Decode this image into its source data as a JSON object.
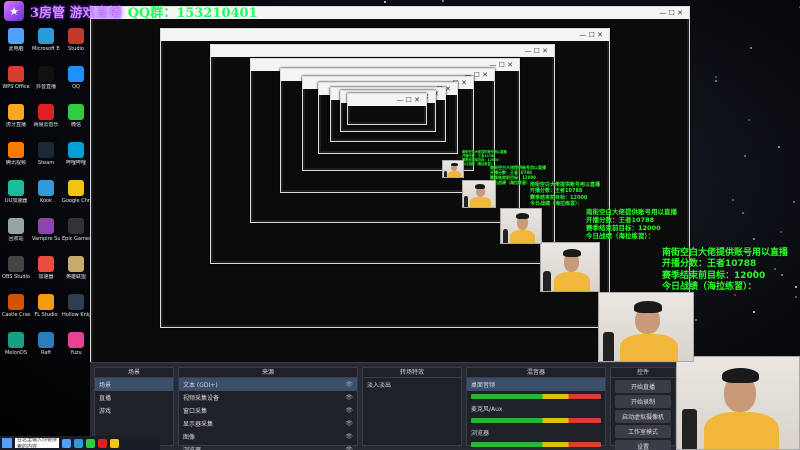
{
  "banner": {
    "streamer_name": "3房管 游戏直播",
    "qq_group": "QQ群：153210401"
  },
  "colors": {
    "overlay_text": "#2bff2b",
    "banner_name": "#d38bff",
    "obs_bg": "#272a33"
  },
  "desktop_icons": [
    {
      "label": "此电脑",
      "icon": "computer-icon",
      "color": "#4fa3ff"
    },
    {
      "label": "Microsoft Edge",
      "icon": "edge-icon",
      "color": "#2c9ad7"
    },
    {
      "label": "Studio",
      "icon": "app-icon",
      "color": "#c0392b"
    },
    {
      "label": "WPS Office",
      "icon": "wps-icon",
      "color": "#d63b2f"
    },
    {
      "label": "抖音直播",
      "icon": "douyin-icon",
      "color": "#111111"
    },
    {
      "label": "QQ",
      "icon": "qq-icon",
      "color": "#1e90ff"
    },
    {
      "label": "虎牙直播",
      "icon": "huya-icon",
      "color": "#f5a623"
    },
    {
      "label": "网易云音乐",
      "icon": "music-icon",
      "color": "#e02020"
    },
    {
      "label": "微信",
      "icon": "wechat-icon",
      "color": "#2ecc40"
    },
    {
      "label": "腾讯视频",
      "icon": "video-icon",
      "color": "#ff7a00"
    },
    {
      "label": "Steam",
      "icon": "steam-icon",
      "color": "#1b2838"
    },
    {
      "label": "哔哩哔哩",
      "icon": "bilibili-icon",
      "color": "#00a1d6"
    },
    {
      "label": "UU加速器",
      "icon": "uu-icon",
      "color": "#1abc9c"
    },
    {
      "label": "Kook",
      "icon": "kook-icon",
      "color": "#3498db"
    },
    {
      "label": "Google Chrome",
      "icon": "chrome-icon",
      "color": "#f1c40f"
    },
    {
      "label": "回收站",
      "icon": "recycle-bin-icon",
      "color": "#95a5a6"
    },
    {
      "label": "Vampire Survivors",
      "icon": "game-icon",
      "color": "#8e44ad"
    },
    {
      "label": "Epic Games",
      "icon": "epic-icon",
      "color": "#333333"
    },
    {
      "label": "OBS Studio",
      "icon": "obs-icon",
      "color": "#444444"
    },
    {
      "label": "加速器",
      "icon": "boost-icon",
      "color": "#e74c3c"
    },
    {
      "label": "英雄联盟",
      "icon": "lol-icon",
      "color": "#c8aa6e"
    },
    {
      "label": "Castle Crashers",
      "icon": "castle-icon",
      "color": "#d35400"
    },
    {
      "label": "FL Studio",
      "icon": "flstudio-icon",
      "color": "#f39c12"
    },
    {
      "label": "Hollow Knight",
      "icon": "knight-icon",
      "color": "#2c3e50"
    },
    {
      "label": "MelonDS",
      "icon": "emulator-icon",
      "color": "#16a085"
    },
    {
      "label": "Raft",
      "icon": "raft-icon",
      "color": "#2980b9"
    },
    {
      "label": "Yuzu",
      "icon": "switch-icon",
      "color": "#e84393"
    }
  ],
  "overlay": {
    "line1": "南街空白大佬提供账号用以直播",
    "line2": "开播分数：王者10788",
    "line3": "赛季结束前目标：12000",
    "line4": "今日战绩（海拉练習）："
  },
  "obs": {
    "scenes_header": "场景",
    "sources_header": "来源",
    "mixer_header": "混音器",
    "transitions_header": "转场特效",
    "controls_header": "控件",
    "scenes": [
      "场景",
      "直播",
      "游戏"
    ],
    "sources": [
      "文本 (GDI+)",
      "视频采集设备",
      "窗口采集",
      "显示器采集",
      "图像",
      "浏览器",
      "色源"
    ],
    "mixer_tracks": [
      "桌面音频",
      "麦克风/Aux",
      "浏览器"
    ],
    "transition_value": "淡入淡出",
    "controls": [
      "开始直播",
      "开始录制",
      "启动虚拟摄像机",
      "工作室模式",
      "设置",
      "退出"
    ]
  },
  "taskbar": {
    "search_placeholder": "在这里输入你要搜索的内容"
  }
}
